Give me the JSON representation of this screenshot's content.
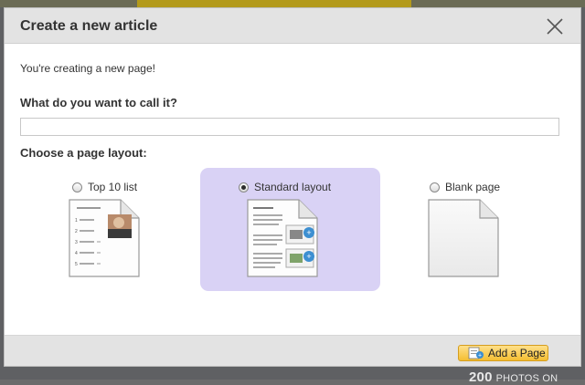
{
  "background": {
    "bottom_count": "200",
    "bottom_caption": "PHOTOS ON"
  },
  "modal": {
    "title": "Create a new article",
    "intro": "You're creating a new page!",
    "name_question": "What do you want to call it?",
    "name_value": "",
    "layout_question": "Choose a page layout:",
    "layouts": [
      {
        "label": "Top 10 list",
        "selected": false
      },
      {
        "label": "Standard layout",
        "selected": true
      },
      {
        "label": "Blank page",
        "selected": false
      }
    ],
    "add_button_label": "Add a Page"
  },
  "colors": {
    "selected_layout_bg": "#d9d2f5",
    "button_gold": "#f4be32",
    "header_gray": "#e3e3e3"
  }
}
